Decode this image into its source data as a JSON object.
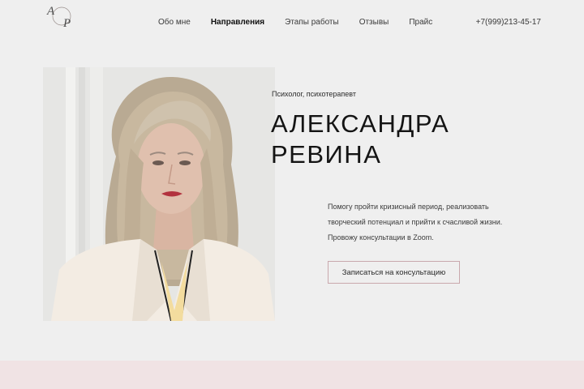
{
  "header": {
    "logo_alt": "АР",
    "nav": [
      {
        "label": "Обо  мне",
        "active": false
      },
      {
        "label": "Направления",
        "active": true
      },
      {
        "label": "Этапы работы",
        "active": false
      },
      {
        "label": "Отзывы",
        "active": false
      },
      {
        "label": "Прайс",
        "active": false
      }
    ],
    "phone": "+7(999)213-45-17"
  },
  "hero": {
    "subtitle": "Психолог, психотерапевт",
    "name_line1": "АЛЕКСАНДРА",
    "name_line2": "РЕВИНА",
    "description": [
      "Помогу пройти кризисный период, реализовать",
      "творческий потенциал и прийти к счасливой жизни.",
      "Провожу консультации в Zoom."
    ],
    "cta_label": "Записаться на консультацию"
  },
  "colors": {
    "background": "#efefef",
    "accent_border": "#c9a8ad",
    "bottom_band": "#f0e3e4"
  }
}
